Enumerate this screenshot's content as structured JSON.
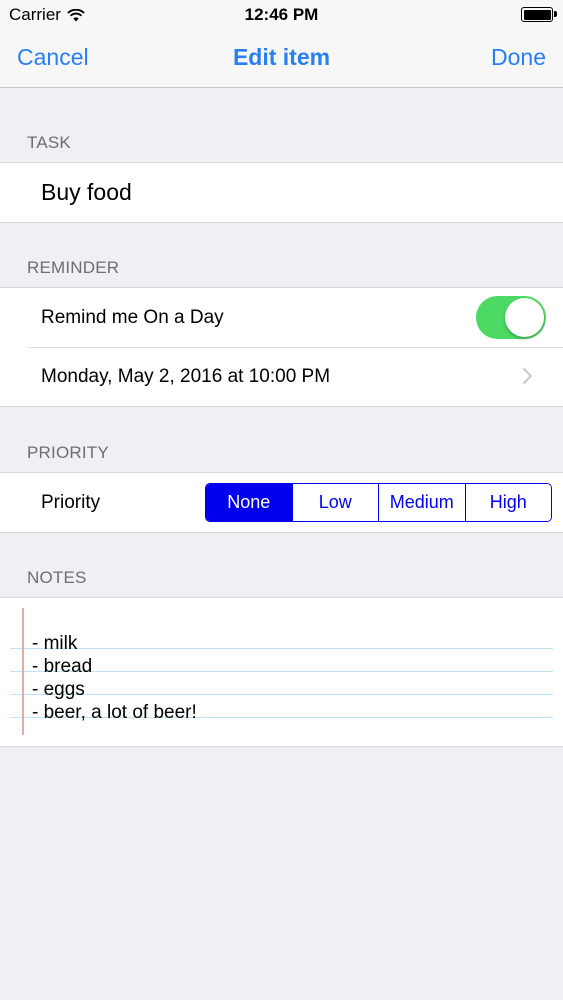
{
  "status_bar": {
    "carrier": "Carrier",
    "time": "12:46 PM"
  },
  "nav": {
    "cancel": "Cancel",
    "title": "Edit item",
    "done": "Done"
  },
  "sections": {
    "task": {
      "header": "TASK",
      "value": "Buy food"
    },
    "reminder": {
      "header": "REMINDER",
      "toggle_label": "Remind me On a Day",
      "toggle_on": true,
      "toggle_color": "#4cd964",
      "date": "Monday, May 2, 2016 at 10:00 PM"
    },
    "priority": {
      "header": "PRIORITY",
      "label": "Priority",
      "options": [
        "None",
        "Low",
        "Medium",
        "High"
      ],
      "selected": "None",
      "tint_color": "#0000ee"
    },
    "notes": {
      "header": "NOTES",
      "lines": [
        "- milk",
        "- bread",
        "- eggs",
        "- beer, a lot of beer!"
      ]
    }
  },
  "colors": {
    "accent": "#2a7ef4",
    "background": "#efeff4"
  },
  "icons": {
    "wifi": "wifi-icon",
    "battery": "battery-icon",
    "disclosure": "chevron-right-icon"
  }
}
